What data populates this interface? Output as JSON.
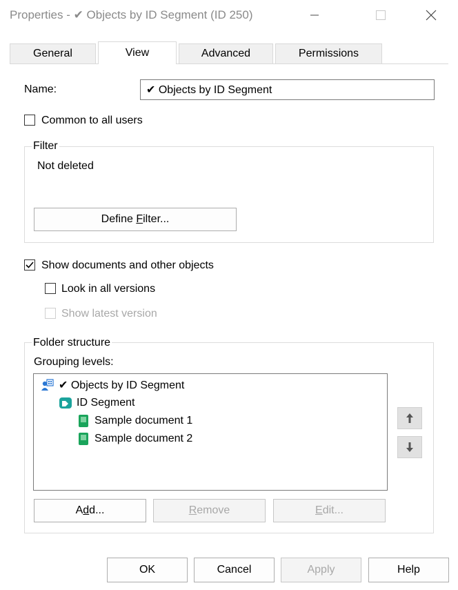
{
  "window": {
    "title": "Properties - ✔ Objects by ID Segment (ID 250)"
  },
  "tabs": [
    {
      "label": "General"
    },
    {
      "label": "View"
    },
    {
      "label": "Advanced"
    },
    {
      "label": "Permissions"
    }
  ],
  "active_tab": "View",
  "name_field": {
    "label": "Name:",
    "value": "✔ Objects by ID Segment"
  },
  "common_to_all_users": {
    "label": "Common to all users",
    "checked": false
  },
  "filter": {
    "legend": "Filter",
    "value": "Not deleted",
    "button_label": "Define Filter...",
    "button_mnemonic_prefix": "Define ",
    "button_mnemonic_letter": "F",
    "button_mnemonic_suffix": "ilter..."
  },
  "show_documents": {
    "label": "Show documents and other objects",
    "checked": true
  },
  "look_in_all_versions": {
    "label": "Look in all versions",
    "checked": false
  },
  "show_latest_version": {
    "label": "Show latest version",
    "checked": false,
    "disabled": true
  },
  "folder_structure": {
    "legend": "Folder structure",
    "grouping_label": "Grouping levels:",
    "tree": [
      {
        "label": "✔ Objects by ID Segment",
        "icon": "view-icon",
        "level": 0
      },
      {
        "label": "ID Segment",
        "icon": "segment-icon",
        "level": 1
      },
      {
        "label": "Sample document 1",
        "icon": "document-icon",
        "level": 2
      },
      {
        "label": "Sample document 2",
        "icon": "document-icon",
        "level": 2
      }
    ],
    "buttons": {
      "add": {
        "pre": "A",
        "mn": "d",
        "post": "d..."
      },
      "remove": {
        "pre": "",
        "mn": "R",
        "post": "emove"
      },
      "edit": {
        "pre": "",
        "mn": "E",
        "post": "dit..."
      }
    },
    "move_up_icon": "arrow-up-icon",
    "move_down_icon": "arrow-down-icon"
  },
  "footer": {
    "ok": "OK",
    "cancel": "Cancel",
    "apply": "Apply",
    "help": "Help"
  },
  "colors": {
    "accent_green": "#1aa45b",
    "teal": "#1ba39c",
    "blue": "#2b78d4",
    "disabled_text": "#a8a8a8"
  }
}
